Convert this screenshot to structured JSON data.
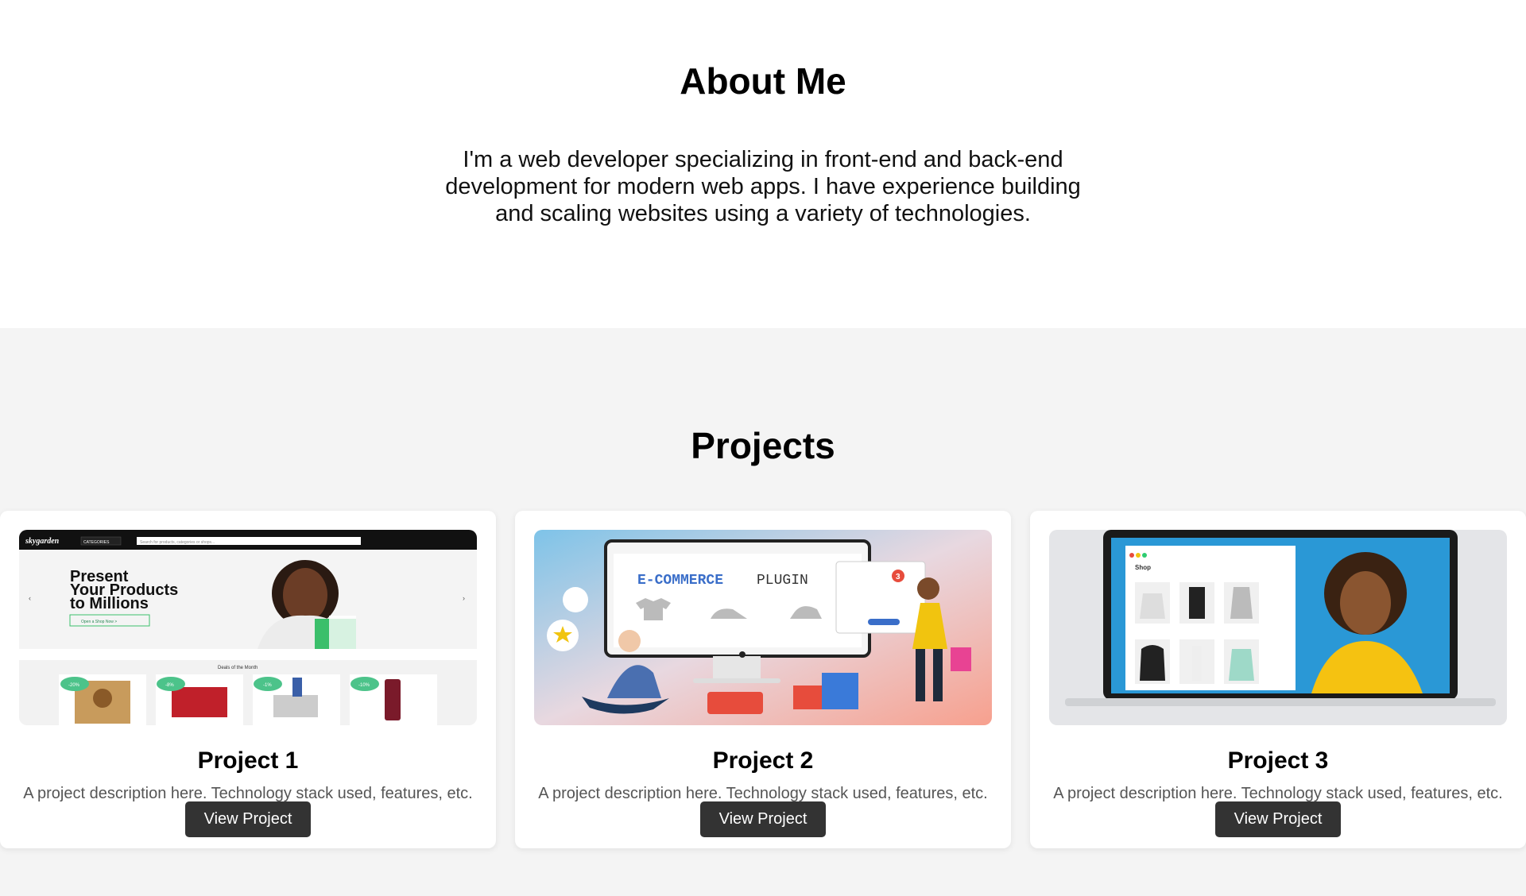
{
  "about": {
    "title": "About Me",
    "text": "I'm a web developer specializing in front-end and back-end development for modern web apps. I have experience building and scaling websites using a variety of technologies."
  },
  "projects": {
    "title": "Projects",
    "items": [
      {
        "title": "Project 1",
        "description": "A project description here. Technology stack used, features, etc.",
        "button": "View Project",
        "thumb": {
          "brand": "skygarden",
          "categories": "CATEGORIES",
          "search": "Search for products, categories or shops...",
          "headline1": "Present",
          "headline2": "Your Products",
          "headline3": "to Millions",
          "cta": "Open a Shop Now >",
          "deals": "Deals of the Month",
          "b1": "-20%",
          "b2": "-8%",
          "b3": "-1%",
          "b4": "-10%"
        }
      },
      {
        "title": "Project 2",
        "description": "A project description here. Technology stack used, features, etc.",
        "button": "View Project",
        "thumb": {
          "accent": "E-COMMERCE",
          "plain": "PLUGIN",
          "cart_count": "3"
        }
      },
      {
        "title": "Project 3",
        "description": "A project description here. Technology stack used, features, etc.",
        "button": "View Project",
        "thumb": {
          "shop": "Shop"
        }
      }
    ]
  },
  "colors": {
    "button": "#333333",
    "section_bg": "#f4f4f4",
    "accent_green": "#4cc38a",
    "accent_blue": "#3a6ec9"
  }
}
